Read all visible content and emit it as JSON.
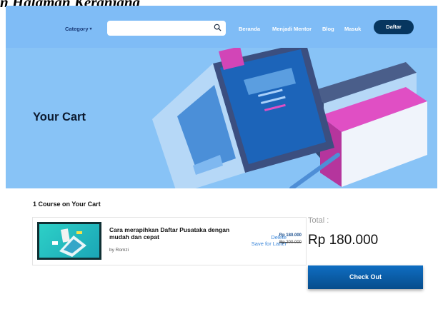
{
  "document_heading": "n Halaman Keranjang",
  "navbar": {
    "category_label": "Category",
    "search": {
      "value": "",
      "placeholder": ""
    },
    "links": [
      "Beranda",
      "Menjadi Mentor",
      "Blog",
      "Masuk"
    ],
    "signup_button": "Daftar",
    "background_color": "#7fbcf6",
    "button_color": "#07365f"
  },
  "hero": {
    "title": "Your Cart",
    "background_color": "#88c3f6"
  },
  "cart": {
    "heading": "1 Course on Your Cart",
    "items": [
      {
        "title": "Cara merapihkan Daftar Pusataka dengan mudah dan cepat",
        "author": "by  Romzi",
        "delete_label": "Delete",
        "save_label": "Save for Latter",
        "price": "Rp 180.000",
        "old_price": "Rp 200.000"
      }
    ]
  },
  "summary": {
    "total_label": "Total :",
    "total_value": "Rp 180.000",
    "checkout_button": "Check Out",
    "checkout_color": "#0b5fa8"
  },
  "icons": {
    "search": "search-icon",
    "category_caret": "caret-down-icon"
  }
}
